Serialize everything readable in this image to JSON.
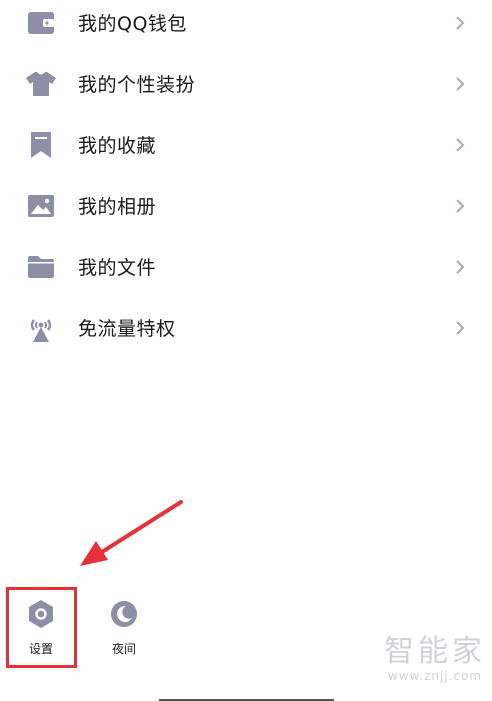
{
  "menu": {
    "items": [
      {
        "label": "我的QQ钱包",
        "icon": "wallet-icon"
      },
      {
        "label": "我的个性装扮",
        "icon": "tshirt-icon"
      },
      {
        "label": "我的收藏",
        "icon": "bookmark-icon"
      },
      {
        "label": "我的相册",
        "icon": "picture-icon"
      },
      {
        "label": "我的文件",
        "icon": "folder-icon"
      },
      {
        "label": "免流量特权",
        "icon": "broadcast-tower-icon"
      }
    ]
  },
  "bottom_bar": {
    "settings": {
      "label": "设置",
      "icon": "settings-hexagon-icon"
    },
    "night": {
      "label": "夜间",
      "icon": "moon-icon"
    }
  },
  "watermark": {
    "brand": "智能家",
    "url": "www.znjj.com"
  },
  "colors": {
    "icon": "#8c8fa6",
    "chevron": "#a9abb8",
    "highlight": "#e8303a",
    "arrow": "#e8303a"
  }
}
